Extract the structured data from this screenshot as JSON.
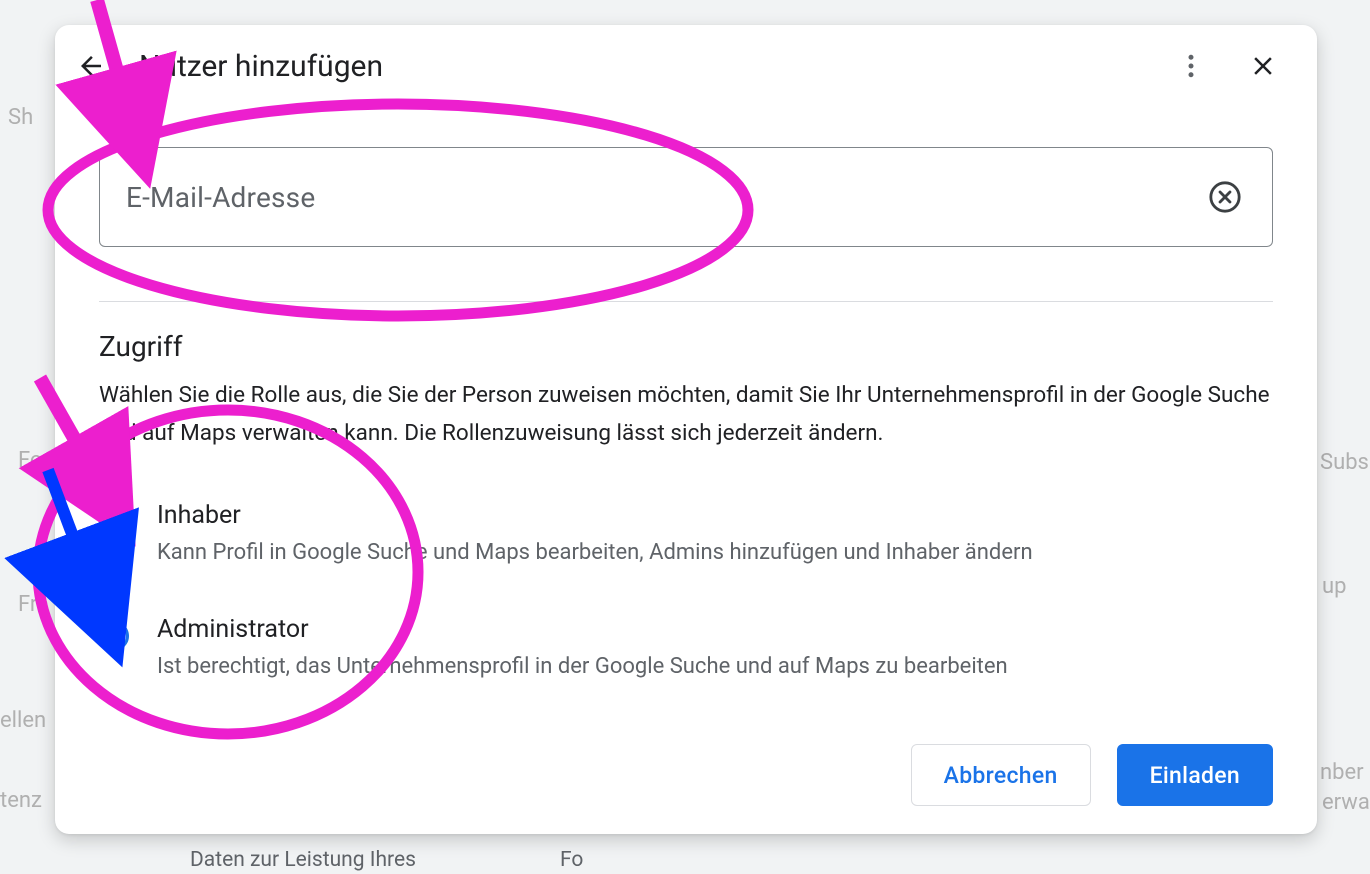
{
  "dialog": {
    "title": "Nutzer hinzufügen",
    "email": {
      "placeholder": "E-Mail-Adresse",
      "value": ""
    },
    "access": {
      "heading": "Zugriff",
      "description": "Wählen Sie die Rolle aus, die Sie der Person zuweisen möchten, damit Sie Ihr Unternehmensprofil in der Google Suche und auf Maps verwalten kann. Die Rollenzuweisung lässt sich jederzeit ändern.",
      "options": [
        {
          "label": "Inhaber",
          "description": "Kann Profil in Google Suche und Maps bearbeiten, Admins hinzufügen und Inhaber ändern",
          "selected": false
        },
        {
          "label": "Administrator",
          "description": "Ist berechtigt, das Unternehmensprofil in der Google Suche und auf Maps zu bearbeiten",
          "selected": true
        }
      ]
    },
    "buttons": {
      "cancel": "Abbrechen",
      "invite": "Einladen"
    }
  },
  "annotation_colors": {
    "pink": "#ec1fce",
    "blue": "#0038ff"
  }
}
